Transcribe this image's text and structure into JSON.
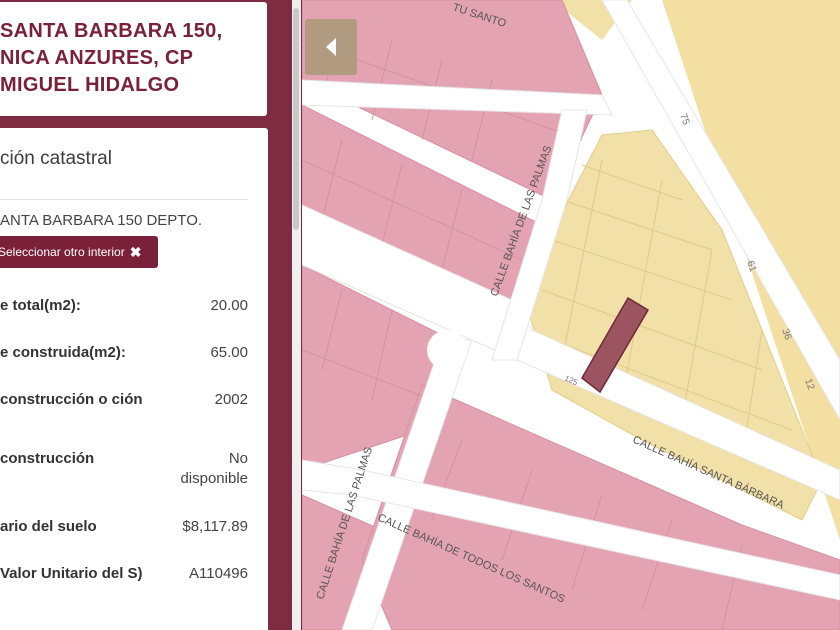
{
  "address_card": {
    "lines": [
      "SANTA BARBARA 150,",
      "NICA ANZURES, CP",
      "MIGUEL HIDALGO"
    ]
  },
  "info": {
    "title": "ción catastral",
    "subtitle": "ANTA BARBARA 150 DEPTO.",
    "select_button": "Seleccionar otro interior",
    "close_glyph": "✖",
    "rows": [
      {
        "label": "e total(m2):",
        "value": "20.00"
      },
      {
        "label": "e construida(m2):",
        "value": "65.00"
      },
      {
        "label": "construcción o ción",
        "value": "2002"
      },
      {
        "label": "construcción",
        "value": "No disponible"
      },
      {
        "label": "ario del suelo",
        "value": "$8,117.89"
      },
      {
        "label": "Valor Unitario del S)",
        "value": "A110496"
      }
    ]
  },
  "map": {
    "back_icon": "chevron-left-icon",
    "colors": {
      "pink_parcel": "#e4a3b2",
      "yellow_parcel": "#f1e0a8",
      "selected_parcel": "#9b5460",
      "road": "#ffffff",
      "sidebar": "#7d2c42",
      "back_button": "#b09a80"
    },
    "street_labels": {
      "palmas_upper": "CALLE BAHÍA DE LAS PALMAS",
      "palmas_lower": "CALLE BAHÍA DE LAS PALMAS",
      "santa_barbara": "CALLE BAHÍA SANTA BÁRBARA",
      "todos_santos": "CALLE BAHÍA DE TODOS LOS SANTOS",
      "top": "TU SANTO",
      "small_right_1": "75",
      "small_right_2": "61",
      "small_right_3": "36",
      "small_right_4": "12",
      "small_mid": "125"
    }
  }
}
